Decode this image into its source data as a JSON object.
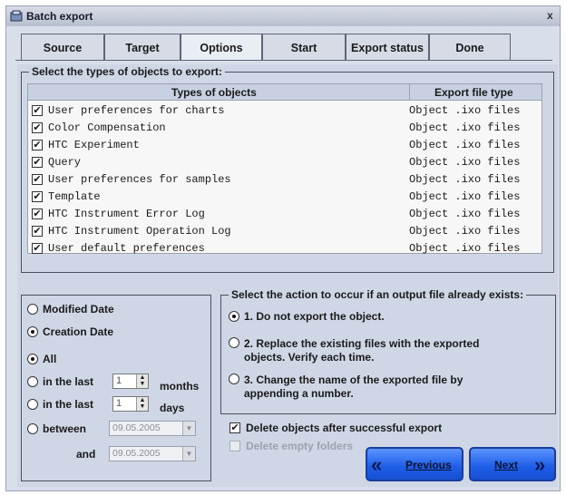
{
  "window": {
    "title": "Batch export",
    "close_label": "x"
  },
  "tabs": [
    {
      "label": "Source"
    },
    {
      "label": "Target"
    },
    {
      "label": "Options"
    },
    {
      "label": "Start"
    },
    {
      "label": "Export status"
    },
    {
      "label": "Done"
    }
  ],
  "active_tab": "Options",
  "types_group": {
    "legend": "Select the types of objects to export:",
    "col_type": "Types of objects",
    "col_export": "Export file type",
    "rows": [
      {
        "name": "User preferences for charts",
        "ext": "Object .ixo files",
        "checked": true
      },
      {
        "name": "Color Compensation",
        "ext": "Object .ixo files",
        "checked": true
      },
      {
        "name": "HTC Experiment",
        "ext": "Object .ixo files",
        "checked": true
      },
      {
        "name": "Query",
        "ext": "Object .ixo files",
        "checked": true
      },
      {
        "name": "User preferences for samples",
        "ext": "Object .ixo files",
        "checked": true
      },
      {
        "name": "Template",
        "ext": "Object .ixo files",
        "checked": true
      },
      {
        "name": "HTC Instrument Error Log",
        "ext": "Object .ixo files",
        "checked": true
      },
      {
        "name": "HTC Instrument Operation Log",
        "ext": "Object .ixo files",
        "checked": true
      },
      {
        "name": "User default preferences",
        "ext": "Object .ixo files",
        "checked": true
      }
    ]
  },
  "date_filter": {
    "modified": "Modified Date",
    "creation": "Creation Date",
    "all": "All",
    "in_last_1": "in the last",
    "months_value": "1",
    "months": "months",
    "in_last_2": "in the last",
    "days_value": "1",
    "days": "days",
    "between": "between",
    "from_date": "09.05.2005",
    "and": "and",
    "to_date": "09.05.2005"
  },
  "action_group": {
    "legend": "Select the action to occur if an output file already exists:",
    "opt1": "1. Do not export the object.",
    "opt2_line1": "2. Replace the existing files with the exported",
    "opt2_line2": "objects. Verify each time.",
    "opt3_line1": "3. Change the name of the exported file by",
    "opt3_line2": "appending a number."
  },
  "delete_after": {
    "label": "Delete objects after successful export",
    "checked": true
  },
  "delete_empty": {
    "label": "Delete empty folders",
    "checked": false
  },
  "buttons": {
    "previous": "Previous",
    "next": "Next"
  },
  "icons": {
    "previous_icon": "double-chevron-left",
    "next_icon": "double-chevron-right"
  },
  "colors": {
    "nav_button": "#2a66f0",
    "panel": "#cfd7e6"
  }
}
